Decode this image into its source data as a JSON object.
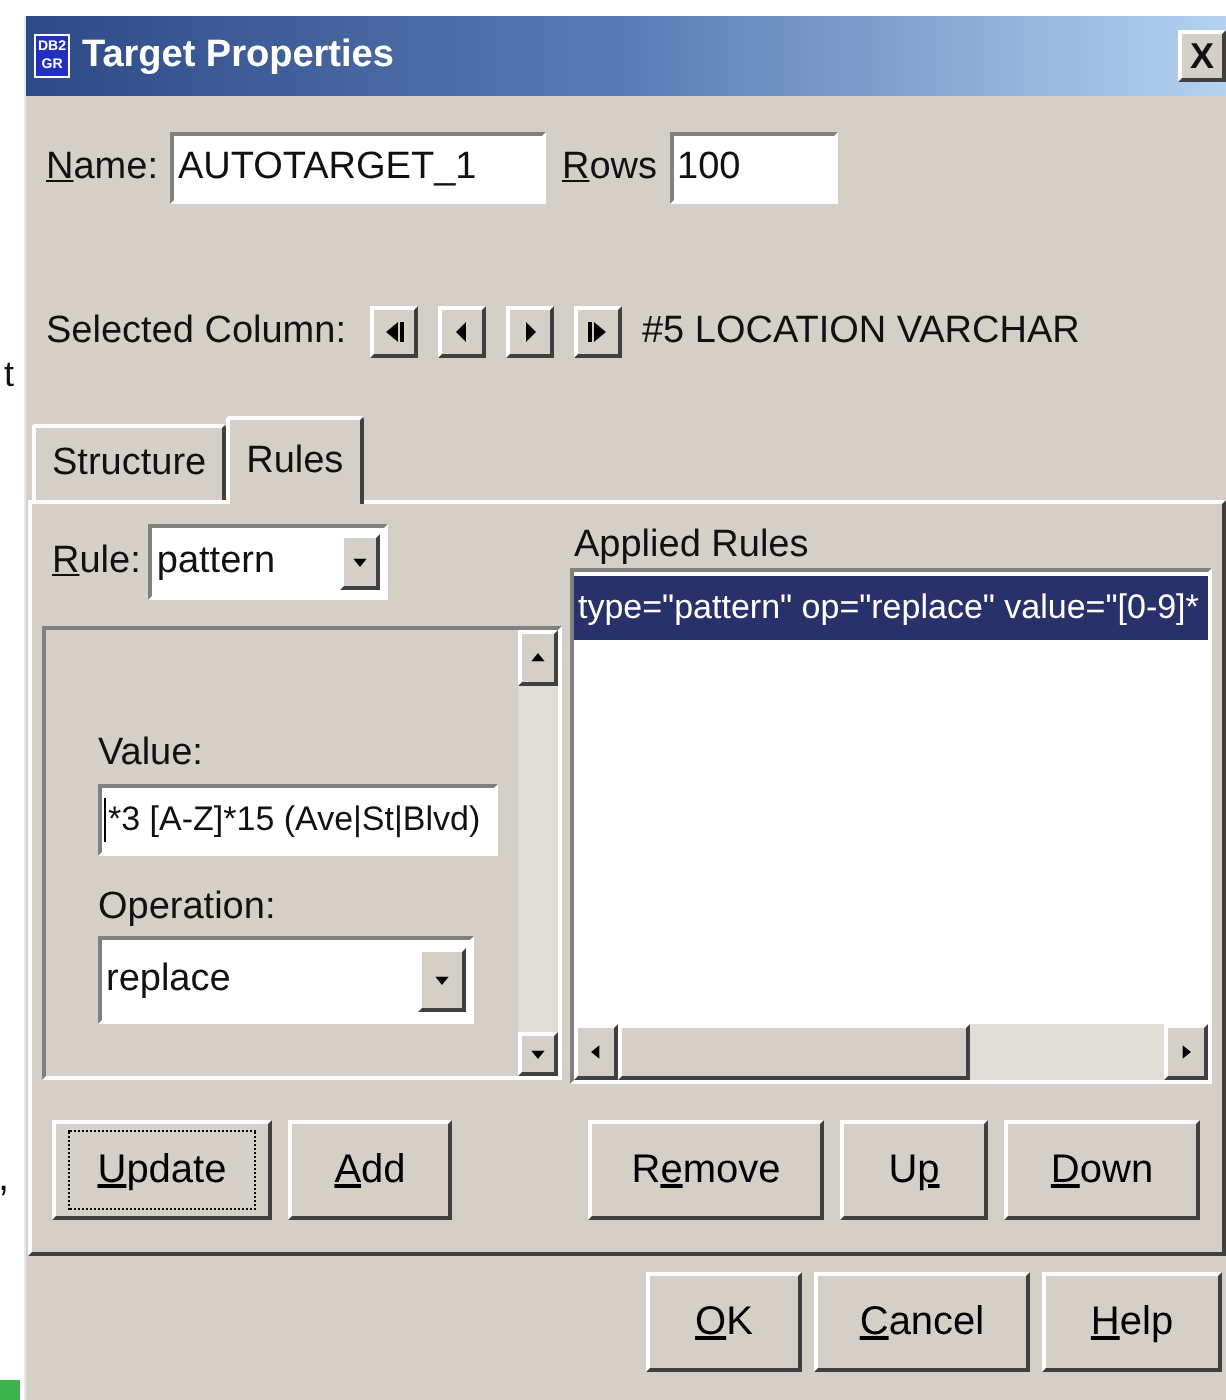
{
  "background_text": [
    "t",
    ","
  ],
  "window": {
    "icon_text": [
      "DB2",
      "GR"
    ],
    "title": "Target Properties",
    "close": "X"
  },
  "name": {
    "accesskey": "N",
    "label_end": "ame:",
    "value": "AUTOTARGET_1"
  },
  "rows": {
    "accesskey": "R",
    "label_end": "ows",
    "value": "100"
  },
  "selected_column": {
    "label": "Selected Column:",
    "value": "#5 LOCATION VARCHAR"
  },
  "tabs": [
    {
      "label": "Structure",
      "selected": false
    },
    {
      "label": "Rules",
      "selected": true
    }
  ],
  "rule": {
    "accesskey": "R",
    "label_end": "ule:",
    "value": "pattern"
  },
  "value": {
    "label": "Value:",
    "value": "*3 [A-Z]*15 (Ave|St|Blvd)"
  },
  "operation": {
    "label": "Operation:",
    "value": "replace"
  },
  "applied_rules": {
    "label": "Applied Rules",
    "items": [
      {
        "text": "type=\"pattern\" op=\"replace\" value=\"[0-9]*",
        "selected": true
      }
    ]
  },
  "rule_buttons": [
    {
      "accesskey": "U",
      "label_end": "pdate",
      "focused": true
    },
    {
      "accesskey": "A",
      "label_end": "dd",
      "focused": false
    },
    {
      "label_start": "R",
      "accesskey": "e",
      "label_end": "move",
      "focused": false
    },
    {
      "label_start": "U",
      "accesskey": "p",
      "focused": false
    },
    {
      "accesskey": "D",
      "label_end": "own",
      "focused": false
    }
  ],
  "dialog_buttons": [
    {
      "accesskey": "O",
      "label_end": "K"
    },
    {
      "accesskey": "C",
      "label_end": "ancel"
    },
    {
      "accesskey": "H",
      "label_end": "elp"
    }
  ]
}
